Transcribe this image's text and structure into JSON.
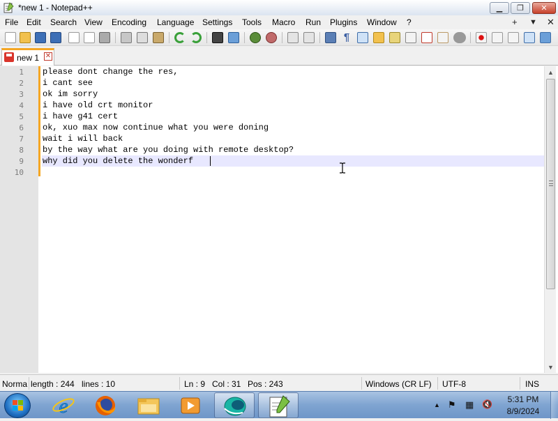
{
  "window": {
    "title": "*new 1 - Notepad++",
    "controls": {
      "minimize": "▁",
      "maximize": "❐",
      "close": "✕"
    }
  },
  "menu": {
    "items": [
      "File",
      "Edit",
      "Search",
      "View",
      "Encoding",
      "Language",
      "Settings",
      "Tools",
      "Macro",
      "Run",
      "Plugins",
      "Window",
      "?"
    ],
    "right": {
      "plus": "+",
      "dropdown": "▼",
      "close": "✕"
    }
  },
  "toolbar": {
    "icons": [
      "new-file-icon",
      "open-file-icon",
      "save-icon",
      "save-all-icon",
      "close-icon",
      "close-all-icon",
      "print-icon",
      "cut-icon",
      "copy-icon",
      "paste-icon",
      "undo-icon",
      "redo-icon",
      "find-icon",
      "replace-icon",
      "zoom-in-icon",
      "zoom-out-icon",
      "sync-vertical-icon",
      "sync-horizontal-icon",
      "word-wrap-icon",
      "show-all-chars-icon",
      "indent-guide-icon",
      "folder-as-workspace-icon",
      "document-map-icon",
      "function-list-icon",
      "document-list-icon",
      "plugin-icon",
      "record-macro-icon",
      "stop-macro-icon",
      "play-macro-icon",
      "run-macro-multiple-icon",
      "save-macro-icon"
    ]
  },
  "tabs": [
    {
      "label": "new 1",
      "close": "✕",
      "modified": true
    }
  ],
  "editor": {
    "lines": [
      {
        "n": "1",
        "text": "please dont change the res,"
      },
      {
        "n": "2",
        "text": "i cant see"
      },
      {
        "n": "3",
        "text": "ok im sorry"
      },
      {
        "n": "4",
        "text": "i have old crt monitor"
      },
      {
        "n": "5",
        "text": "i have g41 cert"
      },
      {
        "n": "6",
        "text": "ok, xuo max now continue what you were doning"
      },
      {
        "n": "7",
        "text": "wait i will back"
      },
      {
        "n": "8",
        "text": "by the way what are you doing with remote desktop?"
      },
      {
        "n": "9",
        "text": "why did you delete the wonderf"
      },
      {
        "n": "10",
        "text": ""
      }
    ],
    "current_line": 9
  },
  "scrollbar": {
    "up": "▲",
    "down": "▼"
  },
  "status": {
    "type": "Norma",
    "length": "length : 244",
    "lines": "lines : 10",
    "ln": "Ln : 9",
    "col": "Col : 31",
    "pos": "Pos : 243",
    "eol": "Windows (CR LF)",
    "encoding": "UTF-8",
    "mode": "INS"
  },
  "taskbar": {
    "apps": [
      "internet-explorer-icon",
      "firefox-icon",
      "file-explorer-icon",
      "media-player-icon",
      "remote-desktop-icon",
      "notepadpp-icon"
    ],
    "tray": {
      "up_arrow": "▲",
      "flag": "⚑",
      "network": "▦",
      "volume": "🔇"
    },
    "time": "5:31 PM",
    "date": "8/9/2024"
  },
  "colors": {
    "accent_tab": "#f5a623",
    "current_line_bg": "#e8e8ff",
    "gutter_bg": "#e4e4e4",
    "taskbar": "#7fa4d1"
  }
}
